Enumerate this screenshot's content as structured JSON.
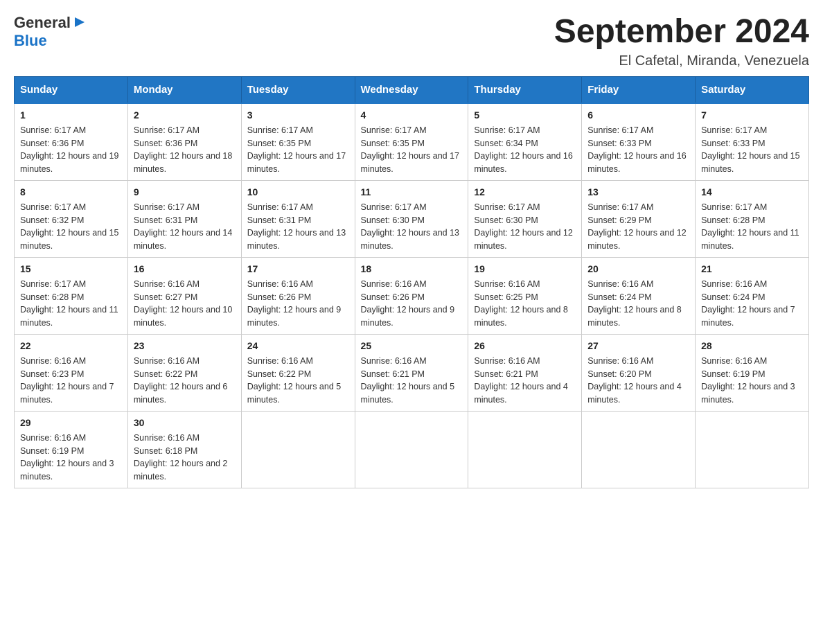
{
  "logo": {
    "text_general": "General",
    "text_blue": "Blue"
  },
  "title": "September 2024",
  "location": "El Cafetal, Miranda, Venezuela",
  "days_header": [
    "Sunday",
    "Monday",
    "Tuesday",
    "Wednesday",
    "Thursday",
    "Friday",
    "Saturday"
  ],
  "weeks": [
    [
      {
        "day": "1",
        "sunrise": "6:17 AM",
        "sunset": "6:36 PM",
        "daylight": "12 hours and 19 minutes."
      },
      {
        "day": "2",
        "sunrise": "6:17 AM",
        "sunset": "6:36 PM",
        "daylight": "12 hours and 18 minutes."
      },
      {
        "day": "3",
        "sunrise": "6:17 AM",
        "sunset": "6:35 PM",
        "daylight": "12 hours and 17 minutes."
      },
      {
        "day": "4",
        "sunrise": "6:17 AM",
        "sunset": "6:35 PM",
        "daylight": "12 hours and 17 minutes."
      },
      {
        "day": "5",
        "sunrise": "6:17 AM",
        "sunset": "6:34 PM",
        "daylight": "12 hours and 16 minutes."
      },
      {
        "day": "6",
        "sunrise": "6:17 AM",
        "sunset": "6:33 PM",
        "daylight": "12 hours and 16 minutes."
      },
      {
        "day": "7",
        "sunrise": "6:17 AM",
        "sunset": "6:33 PM",
        "daylight": "12 hours and 15 minutes."
      }
    ],
    [
      {
        "day": "8",
        "sunrise": "6:17 AM",
        "sunset": "6:32 PM",
        "daylight": "12 hours and 15 minutes."
      },
      {
        "day": "9",
        "sunrise": "6:17 AM",
        "sunset": "6:31 PM",
        "daylight": "12 hours and 14 minutes."
      },
      {
        "day": "10",
        "sunrise": "6:17 AM",
        "sunset": "6:31 PM",
        "daylight": "12 hours and 13 minutes."
      },
      {
        "day": "11",
        "sunrise": "6:17 AM",
        "sunset": "6:30 PM",
        "daylight": "12 hours and 13 minutes."
      },
      {
        "day": "12",
        "sunrise": "6:17 AM",
        "sunset": "6:30 PM",
        "daylight": "12 hours and 12 minutes."
      },
      {
        "day": "13",
        "sunrise": "6:17 AM",
        "sunset": "6:29 PM",
        "daylight": "12 hours and 12 minutes."
      },
      {
        "day": "14",
        "sunrise": "6:17 AM",
        "sunset": "6:28 PM",
        "daylight": "12 hours and 11 minutes."
      }
    ],
    [
      {
        "day": "15",
        "sunrise": "6:17 AM",
        "sunset": "6:28 PM",
        "daylight": "12 hours and 11 minutes."
      },
      {
        "day": "16",
        "sunrise": "6:16 AM",
        "sunset": "6:27 PM",
        "daylight": "12 hours and 10 minutes."
      },
      {
        "day": "17",
        "sunrise": "6:16 AM",
        "sunset": "6:26 PM",
        "daylight": "12 hours and 9 minutes."
      },
      {
        "day": "18",
        "sunrise": "6:16 AM",
        "sunset": "6:26 PM",
        "daylight": "12 hours and 9 minutes."
      },
      {
        "day": "19",
        "sunrise": "6:16 AM",
        "sunset": "6:25 PM",
        "daylight": "12 hours and 8 minutes."
      },
      {
        "day": "20",
        "sunrise": "6:16 AM",
        "sunset": "6:24 PM",
        "daylight": "12 hours and 8 minutes."
      },
      {
        "day": "21",
        "sunrise": "6:16 AM",
        "sunset": "6:24 PM",
        "daylight": "12 hours and 7 minutes."
      }
    ],
    [
      {
        "day": "22",
        "sunrise": "6:16 AM",
        "sunset": "6:23 PM",
        "daylight": "12 hours and 7 minutes."
      },
      {
        "day": "23",
        "sunrise": "6:16 AM",
        "sunset": "6:22 PM",
        "daylight": "12 hours and 6 minutes."
      },
      {
        "day": "24",
        "sunrise": "6:16 AM",
        "sunset": "6:22 PM",
        "daylight": "12 hours and 5 minutes."
      },
      {
        "day": "25",
        "sunrise": "6:16 AM",
        "sunset": "6:21 PM",
        "daylight": "12 hours and 5 minutes."
      },
      {
        "day": "26",
        "sunrise": "6:16 AM",
        "sunset": "6:21 PM",
        "daylight": "12 hours and 4 minutes."
      },
      {
        "day": "27",
        "sunrise": "6:16 AM",
        "sunset": "6:20 PM",
        "daylight": "12 hours and 4 minutes."
      },
      {
        "day": "28",
        "sunrise": "6:16 AM",
        "sunset": "6:19 PM",
        "daylight": "12 hours and 3 minutes."
      }
    ],
    [
      {
        "day": "29",
        "sunrise": "6:16 AM",
        "sunset": "6:19 PM",
        "daylight": "12 hours and 3 minutes."
      },
      {
        "day": "30",
        "sunrise": "6:16 AM",
        "sunset": "6:18 PM",
        "daylight": "12 hours and 2 minutes."
      },
      null,
      null,
      null,
      null,
      null
    ]
  ]
}
